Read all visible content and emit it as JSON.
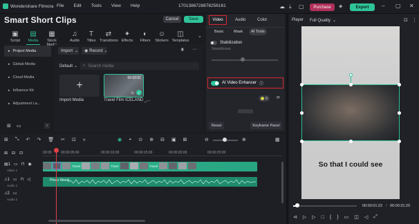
{
  "titlebar": {
    "app_name": "Wondershare Filmora",
    "menu": [
      "File",
      "Edit",
      "Tools",
      "View",
      "Help"
    ],
    "document_id": "1701386728878256161",
    "purchase_label": "Purchase",
    "export_label": "Export"
  },
  "project": {
    "title": "Smart Short Clips",
    "cancel_label": "Cancel",
    "save_label": "Save"
  },
  "toolbar": [
    {
      "label": "Script",
      "icon": "script-icon",
      "glyph": "▣"
    },
    {
      "label": "Media",
      "icon": "media-icon",
      "glyph": "▤"
    },
    {
      "label": "Stock Media",
      "icon": "stock-media-icon",
      "glyph": "▦"
    },
    {
      "label": "Audio",
      "icon": "audio-icon",
      "glyph": "♫"
    },
    {
      "label": "Titles",
      "icon": "titles-icon",
      "glyph": "T"
    },
    {
      "label": "Transitions",
      "icon": "transitions-icon",
      "glyph": "⇄"
    },
    {
      "label": "Effects",
      "icon": "effects-icon",
      "glyph": "✦"
    },
    {
      "label": "Filters",
      "icon": "filters-icon",
      "glyph": "◐"
    },
    {
      "label": "Stickers",
      "icon": "stickers-icon",
      "glyph": "☺"
    },
    {
      "label": "Templates",
      "icon": "templates-icon",
      "glyph": "◫"
    }
  ],
  "sidebar": {
    "items": [
      {
        "label": "Project Media",
        "active": true
      },
      {
        "label": "Global Media",
        "active": false
      },
      {
        "label": "Cloud Media",
        "active": false
      },
      {
        "label": "Influence Kit",
        "active": false
      },
      {
        "label": "Adjustment La...",
        "active": false
      }
    ]
  },
  "media": {
    "import_label": "Import",
    "record_label": "Record",
    "sort_label": "Default",
    "search_placeholder": "Search media",
    "import_media_label": "Import Media",
    "clip_name": "Travel Film ICELAND _...",
    "clip_duration": "00:02:01"
  },
  "properties": {
    "tabs": [
      "Video",
      "Audio",
      "Color"
    ],
    "subtabs": [
      "Basic",
      "Mask",
      "AI Tools"
    ],
    "stabilization_label": "Stabilization",
    "smoothness_label": "Smoothness",
    "ai_enhancer_label": "AI Video Enhancer",
    "credits_value": "6",
    "reset_label": "Reset",
    "keyframe_label": "Keyframe Panel"
  },
  "player": {
    "label": "Player",
    "quality": "Full Quality",
    "caption": "So that I could see",
    "current_time": "00:00:01:22",
    "total_time": "00:00:31:20"
  },
  "timeline": {
    "ruler": [
      "00:00",
      "00:00:05:00",
      "00:00:10:00",
      "00:00:15:00",
      "00:00:20:00",
      "00:00:25:00"
    ],
    "video_track_label": "Video 1",
    "audio_track_label": "Audio 1",
    "audio2_track_label": "Audio 2",
    "audio_clip_label": "Photo Weekl",
    "clip_labels": [
      "Travel",
      "Trave",
      "Travel"
    ]
  },
  "colors": {
    "accent_green": "#2fc39a",
    "highlight_red": "#d9282f",
    "purchase_bg": "#b0305a"
  }
}
